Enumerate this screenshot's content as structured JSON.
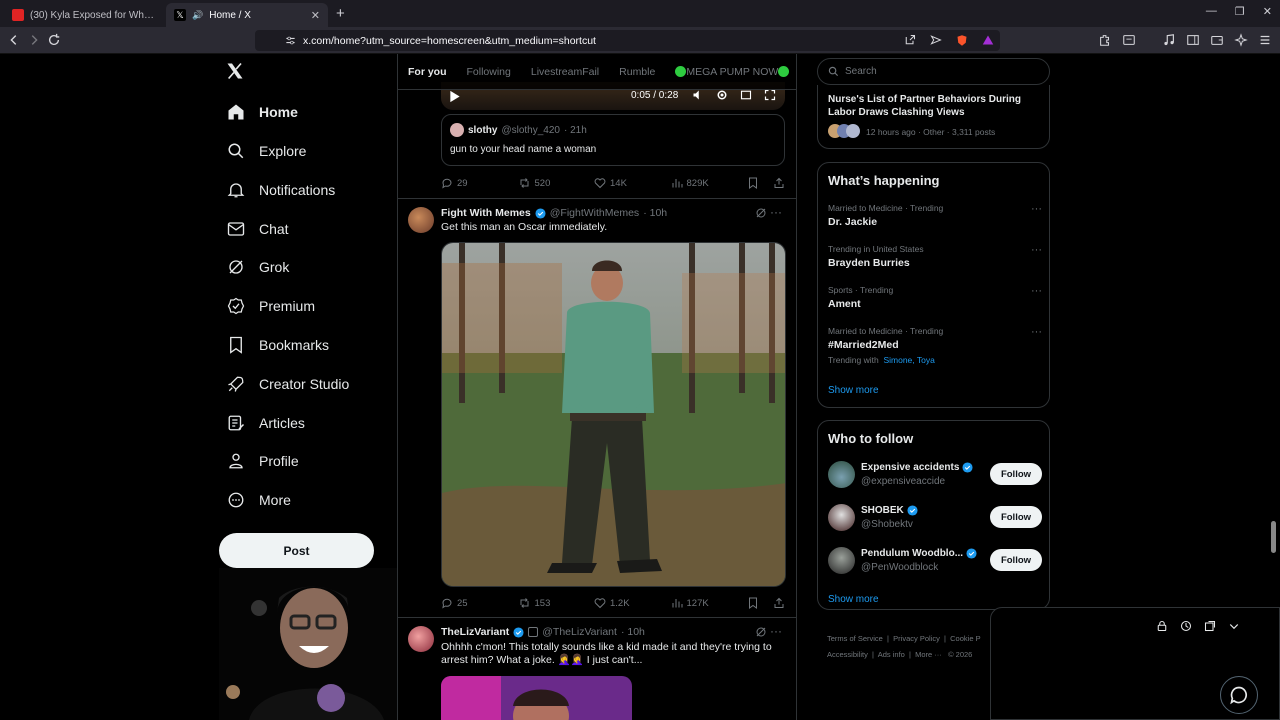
{
  "browser": {
    "tabs": [
      {
        "title": "(30) Kyla Exposed for Who She R",
        "active": false
      },
      {
        "title": "Home / X",
        "active": true
      }
    ],
    "url": "x.com/home?utm_source=homescreen&utm_medium=shortcut"
  },
  "nav": {
    "items": [
      {
        "label": "Home",
        "icon": "home-icon"
      },
      {
        "label": "Explore",
        "icon": "search-icon"
      },
      {
        "label": "Notifications",
        "icon": "bell-icon"
      },
      {
        "label": "Chat",
        "icon": "mail-icon"
      },
      {
        "label": "Grok",
        "icon": "grok-icon"
      },
      {
        "label": "Premium",
        "icon": "verified-icon"
      },
      {
        "label": "Bookmarks",
        "icon": "bookmark-icon"
      },
      {
        "label": "Creator Studio",
        "icon": "rocket-icon"
      },
      {
        "label": "Articles",
        "icon": "article-icon"
      },
      {
        "label": "Profile",
        "icon": "person-icon"
      },
      {
        "label": "More",
        "icon": "more-circle-icon"
      }
    ],
    "post_label": "Post"
  },
  "feed": {
    "tabs": [
      "For you",
      "Following",
      "LivestreamFail",
      "Rumble",
      "MEGA PUMP NOW"
    ],
    "video_time": "0:05 / 0:28",
    "quote": {
      "name": "slothy",
      "handle": "@slothy_420",
      "time": "· 21h",
      "text": "gun to your head name a woman"
    },
    "tweet1_stats": {
      "replies": "29",
      "reposts": "520",
      "likes": "14K",
      "views": "829K"
    },
    "tweet2": {
      "name": "Fight With Memes",
      "handle": "@FightWithMemes",
      "time": "· 10h",
      "text": "Get this man an Oscar immediately.",
      "stats": {
        "replies": "25",
        "reposts": "153",
        "likes": "1.2K",
        "views": "127K"
      }
    },
    "tweet3": {
      "name": "TheLizVariant",
      "handle": "@TheLizVariant",
      "time": "· 10h",
      "text": "Ohhhh c'mon! This totally sounds like a kid made it and they're trying to arrest him? What a joke. 🤦‍♀️🤦‍♀️ I just can't..."
    }
  },
  "sidebar": {
    "search_placeholder": "Search",
    "news": {
      "title": "Nurse's List of Partner Behaviors During Labor Draws Clashing Views",
      "meta": "12 hours ago · Other · 3,311 posts"
    },
    "happening_title": "What’s happening",
    "trends": [
      {
        "meta": "Married to Medicine · Trending",
        "title": "Dr. Jackie"
      },
      {
        "meta": "Trending in United States",
        "title": "Brayden Burries"
      },
      {
        "meta": "Sports · Trending",
        "title": "Ament"
      },
      {
        "meta": "Married to Medicine · Trending",
        "title": "#Married2Med",
        "with_label": "Trending with",
        "with": "Simone, Toya"
      }
    ],
    "show_more": "Show more",
    "follow_title": "Who to follow",
    "who_to_follow": [
      {
        "name": "Expensive accidents",
        "handle": "@expensiveaccide",
        "button": "Follow"
      },
      {
        "name": "SHOBEK",
        "handle": "@Shobektv",
        "button": "Follow"
      },
      {
        "name": "Pendulum Woodblo...",
        "handle": "@PenWoodblock",
        "button": "Follow"
      }
    ],
    "footer": [
      "Terms of Service",
      "Privacy Policy",
      "Cookie P",
      "Accessibility",
      "Ads info",
      "More ···",
      "© 2026"
    ]
  },
  "colors": {
    "accent": "#1d9bf0",
    "bg": "#000000",
    "border": "#2f3336",
    "muted": "#71767b"
  }
}
